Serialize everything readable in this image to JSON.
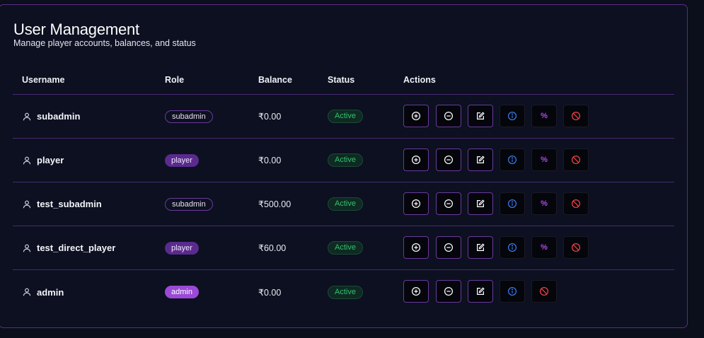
{
  "header": {
    "title": "User Management",
    "subtitle": "Manage player accounts, balances, and status"
  },
  "columns": [
    "Username",
    "Role",
    "Balance",
    "Status",
    "Actions"
  ],
  "rows": [
    {
      "username": "subadmin",
      "role": "subadmin",
      "balance": "₹0.00",
      "status": "Active"
    },
    {
      "username": "player",
      "role": "player",
      "balance": "₹0.00",
      "status": "Active"
    },
    {
      "username": "test_subadmin",
      "role": "subadmin",
      "balance": "₹500.00",
      "status": "Active"
    },
    {
      "username": "test_direct_player",
      "role": "player",
      "balance": "₹60.00",
      "status": "Active"
    },
    {
      "username": "admin",
      "role": "admin",
      "balance": "₹0.00",
      "status": "Active"
    }
  ],
  "actions": {
    "percent_symbol": "%",
    "icons": [
      "plus-circle-icon",
      "minus-circle-icon",
      "edit-icon",
      "info-icon",
      "percent-icon",
      "ban-icon"
    ]
  },
  "colors": {
    "background": "#0b0e1b",
    "border_purple": "#5b2c86",
    "status_green": "#34c070",
    "info_blue": "#3b82f6",
    "ban_red": "#ef4444",
    "percent_purple": "#b04ae8",
    "admin_badge": "#9a4ad6",
    "player_badge": "#5a2a8e"
  }
}
